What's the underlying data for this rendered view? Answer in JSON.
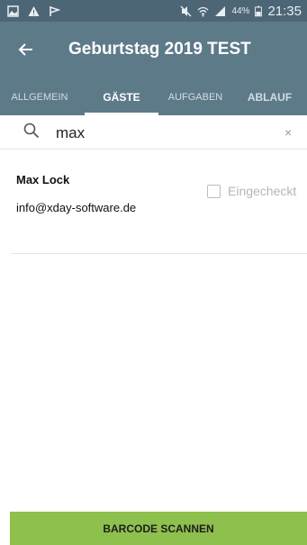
{
  "status_bar": {
    "left_icons": [
      "image-icon",
      "warning-icon",
      "flag-icon"
    ],
    "right_icons": [
      "mute-icon",
      "wifi-icon",
      "signal-icon"
    ],
    "battery": "44%",
    "time": "21:35"
  },
  "app_bar": {
    "back_icon": "arrow-left-icon",
    "title": "Geburtstag 2019 TEST"
  },
  "tabs": [
    {
      "label": "ALLGEMEIN",
      "active": false
    },
    {
      "label": "GÄSTE",
      "active": true
    },
    {
      "label": "AUFGABEN",
      "active": false
    },
    {
      "label": "ABLAUF",
      "active": false
    }
  ],
  "search": {
    "value": "max",
    "icon": "search-icon",
    "clear": "×"
  },
  "guests": [
    {
      "name": "Max Lock",
      "email": "info@xday-software.de",
      "checkin_label": "Eingecheckt",
      "checked": false
    }
  ],
  "footer": {
    "scan_label": "BARCODE SCANNEN"
  },
  "colors": {
    "status_bar": "#4c6676",
    "app_bar": "#5d7a89",
    "accent_green": "#8ec04e"
  }
}
